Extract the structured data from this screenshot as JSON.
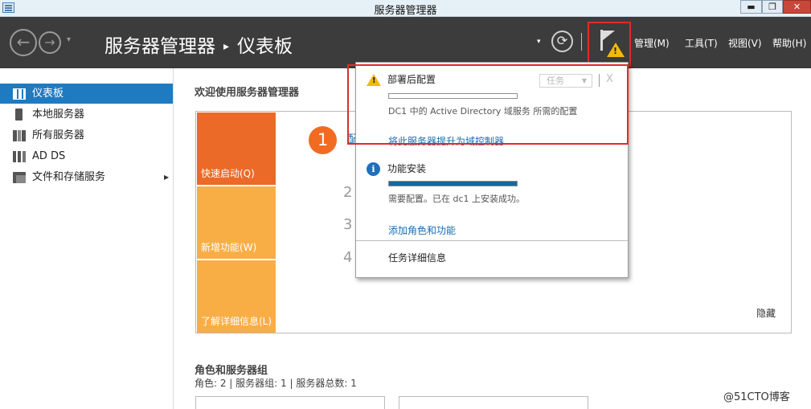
{
  "window": {
    "title": "服务器管理器",
    "min_glyph": "▬",
    "max_glyph": "❐",
    "close_glyph": "✕"
  },
  "header": {
    "back_glyph": "←",
    "forward_glyph": "→",
    "dropdown_glyph": "▾",
    "breadcrumb_root": "服务器管理器",
    "breadcrumb_sep": "▸",
    "breadcrumb_current": "仪表板",
    "refresh_glyph": "⟳",
    "warn_glyph": "!",
    "menus": [
      "管理(M)",
      "工具(T)",
      "视图(V)",
      "帮助(H)"
    ]
  },
  "sidebar": {
    "items": [
      {
        "label": "仪表板",
        "icon": "dashboard-icon"
      },
      {
        "label": "本地服务器",
        "icon": "server-icon"
      },
      {
        "label": "所有服务器",
        "icon": "servers-icon"
      },
      {
        "label": "AD DS",
        "icon": "ad-ds-icon"
      },
      {
        "label": "文件和存储服务",
        "icon": "file-storage-icon"
      }
    ],
    "expand_glyph": "▶"
  },
  "main": {
    "welcome_title": "欢迎使用服务器管理器",
    "tiles": [
      "快速启动(Q)",
      "新增功能(W)",
      "了解详细信息(L)"
    ],
    "step_numbers": [
      "1",
      "2",
      "3",
      "4"
    ],
    "step_one_text": "配",
    "hide_label": "隐藏",
    "roles_title": "角色和服务器组",
    "roles_summary": "角色: 2 | 服务器组: 1 | 服务器总数: 1"
  },
  "notifications": {
    "items": [
      {
        "title": "部署后配置",
        "task_label": "任务",
        "task_caret": "▼",
        "close_glyph": "X",
        "progress": 0,
        "description": "DC1 中的 Active Directory 域服务 所需的配置",
        "link": "将此服务器提升为域控制器"
      },
      {
        "title": "功能安装",
        "info_glyph": "i",
        "progress": 1,
        "description": "需要配置。已在 dc1 上安装成功。",
        "link": "添加角色和功能"
      }
    ],
    "task_details": "任务详细信息"
  },
  "watermark": "@51CTO博客",
  "colors": {
    "accent_blue": "#1f7bc1",
    "header_bg": "#3c3c3c",
    "quick_start_orange": "#ec6a28",
    "tile_amber": "#f9ae45",
    "warning_yellow": "#f2b90c",
    "annotation_red": "#e02b2b"
  }
}
